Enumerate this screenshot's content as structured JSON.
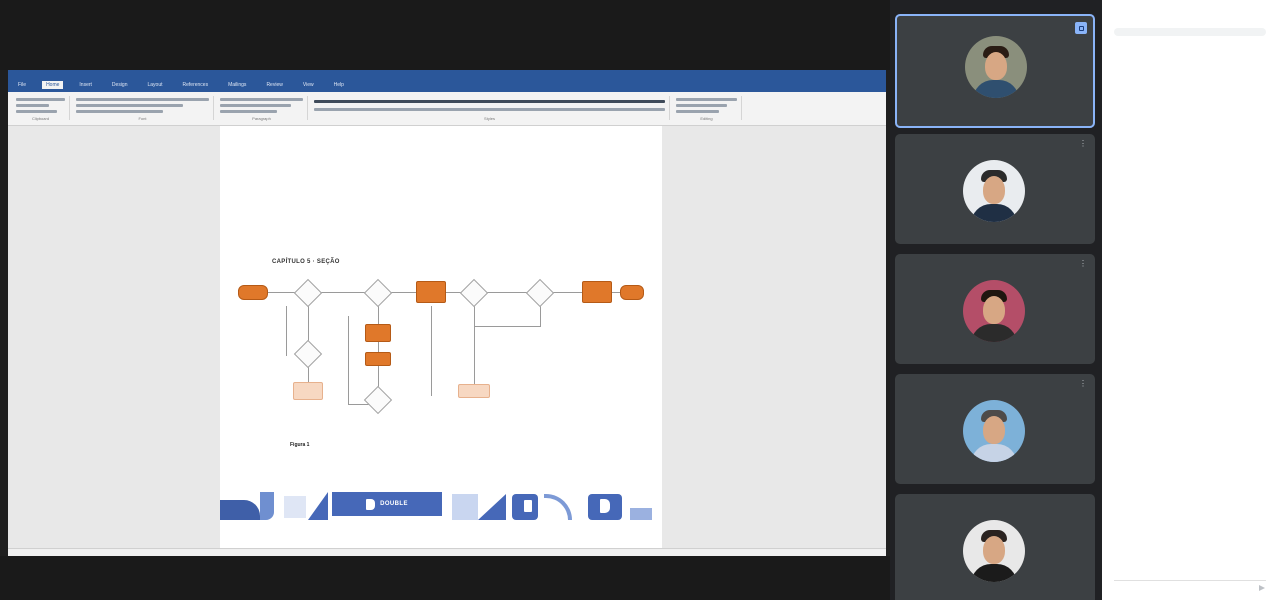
{
  "share": {
    "word": {
      "title": "",
      "menu": [
        "File",
        "Home",
        "Insert",
        "Design",
        "Layout",
        "References",
        "Mailings",
        "Review",
        "View",
        "Help"
      ],
      "ribbon_groups": [
        "Clipboard",
        "Font",
        "Paragraph",
        "Styles",
        "Editing"
      ],
      "status_left": "",
      "status_right": ""
    },
    "document": {
      "paragraph": "",
      "chapter_heading": "CAPÍTULO 5 · SEÇÃO",
      "flowchart_labels": [],
      "caption_label": "Figura 1",
      "caption_text": "",
      "banner_logo_text": "DOUBLE"
    }
  },
  "participants": [
    {
      "name": "",
      "active": true,
      "avatar_body": "#2f4f6f",
      "avatar_bg": "#8a8f7c",
      "avatar_hair": "#2a1c14"
    },
    {
      "name": "",
      "active": false,
      "avatar_body": "#1f2f44",
      "avatar_bg": "#e9ecef",
      "avatar_hair": "#2b2b2b"
    },
    {
      "name": "",
      "active": false,
      "avatar_body": "#2b2b2b",
      "avatar_bg": "#b44e68",
      "avatar_hair": "#1f1610"
    },
    {
      "name": "",
      "active": false,
      "avatar_body": "#c6d3e6",
      "avatar_bg": "#7db1d8",
      "avatar_hair": "#4e4b49"
    },
    {
      "name": "",
      "active": false,
      "avatar_body": "#1b1b1b",
      "avatar_bg": "#e8e8e8",
      "avatar_hair": "#2a2320"
    }
  ],
  "chat": {
    "note": "",
    "messages": [
      {
        "sender": "",
        "time": "",
        "link": ""
      },
      {
        "sender": "",
        "time": "",
        "link": ""
      }
    ],
    "input_placeholder": ""
  },
  "colors": {
    "word_blue": "#2b579a",
    "flow_orange": "#e0782a",
    "flow_soft": "#f7d8c2",
    "active_tile_border": "#8ab4f8",
    "link_blue": "#1a73e8",
    "meet_bg": "#202124"
  },
  "icons": [
    "pin-icon",
    "more-options-icon",
    "send-icon",
    "document-logo-icon"
  ]
}
